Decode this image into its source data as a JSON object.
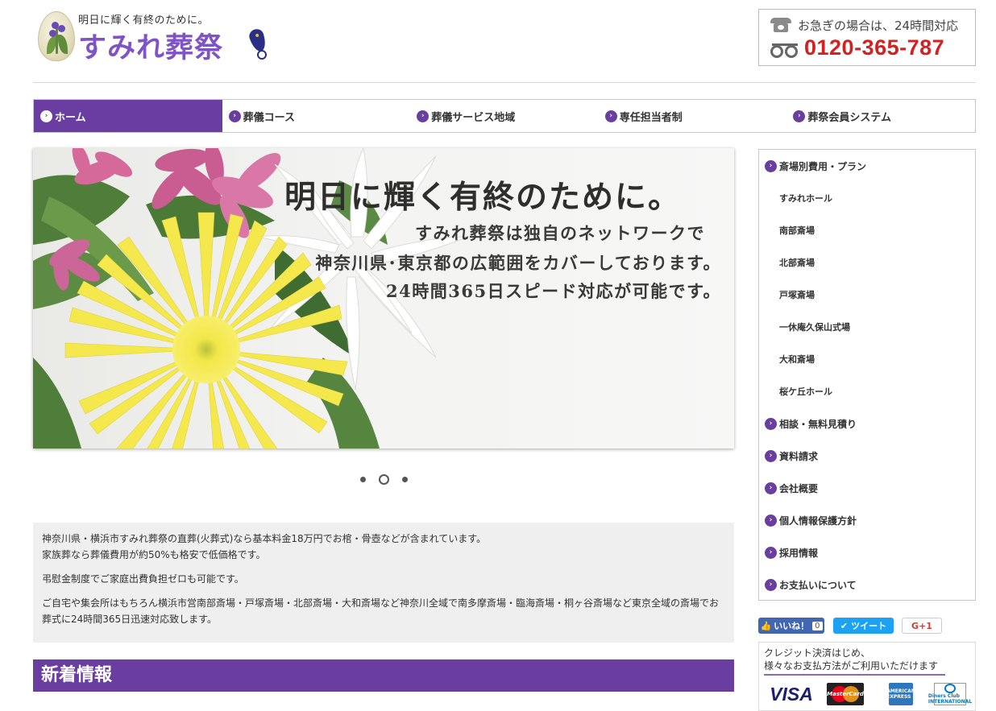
{
  "header": {
    "tagline": "明日に輝く有終のために。",
    "brand": "すみれ葬祭",
    "phone_note": "お急ぎの場合は、24時間対応",
    "phone_number": "0120-365-787"
  },
  "nav": {
    "items": [
      {
        "label": "ホーム",
        "active": true
      },
      {
        "label": "葬儀コース"
      },
      {
        "label": "葬儀サービス地域"
      },
      {
        "label": "専任担当者制"
      },
      {
        "label": "葬祭会員システム"
      }
    ]
  },
  "hero": {
    "title": "明日に輝く有終のために。",
    "lines": [
      "すみれ葬祭は独自のネットワークで",
      "神奈川県･東京都の広範囲をカバーしております。",
      "24時間365日スピード対応が可能です。"
    ],
    "slide_count": 3,
    "active_slide": 2
  },
  "intro": {
    "paragraphs": [
      "神奈川県・横浜市すみれ葬祭の直葬(火葬式)なら基本料金18万円でお棺・骨壺などが含まれています。\n家族葬なら葬儀費用が約50%も格安で低価格です。",
      "弔慰金制度でご家庭出費負担ゼロも可能です。",
      "ご自宅や集会所はもちろん横浜市営南部斎場・戸塚斎場・北部斎場・大和斎場など神奈川全域で南多摩斎場・臨海斎場・桐ヶ谷斎場など東京全域の斎場でお葬式に24時間365日迅速対応致します。"
    ]
  },
  "news": {
    "heading": "新着情報"
  },
  "sidebar": {
    "plan_heading": "斎場別費用・プラン",
    "halls": [
      "すみれホール",
      "南部斎場",
      "北部斎場",
      "戸塚斎場",
      "一休庵久保山式場",
      "大和斎場",
      "桜ケ丘ホール"
    ],
    "links": [
      "相談・無料見積り",
      "資料請求",
      "会社概要",
      "個人情報保護方針",
      "採用情報",
      "お支払いについて"
    ]
  },
  "social": {
    "like_label": "いいね！",
    "like_count": "0",
    "tweet_label": "ツイート",
    "gplus_label": "G+1"
  },
  "payment": {
    "line1": "クレジット決済はじめ、",
    "line2": "様々なお支払方法がご利用いただけます",
    "cards": [
      "VISA",
      "MasterCard",
      "AMERICAN EXPRESS",
      "Diners Club INTERNATIONAL"
    ]
  },
  "colors": {
    "accent": "#6a3ea1",
    "brand": "#7f53c7",
    "phone": "#d42020"
  }
}
